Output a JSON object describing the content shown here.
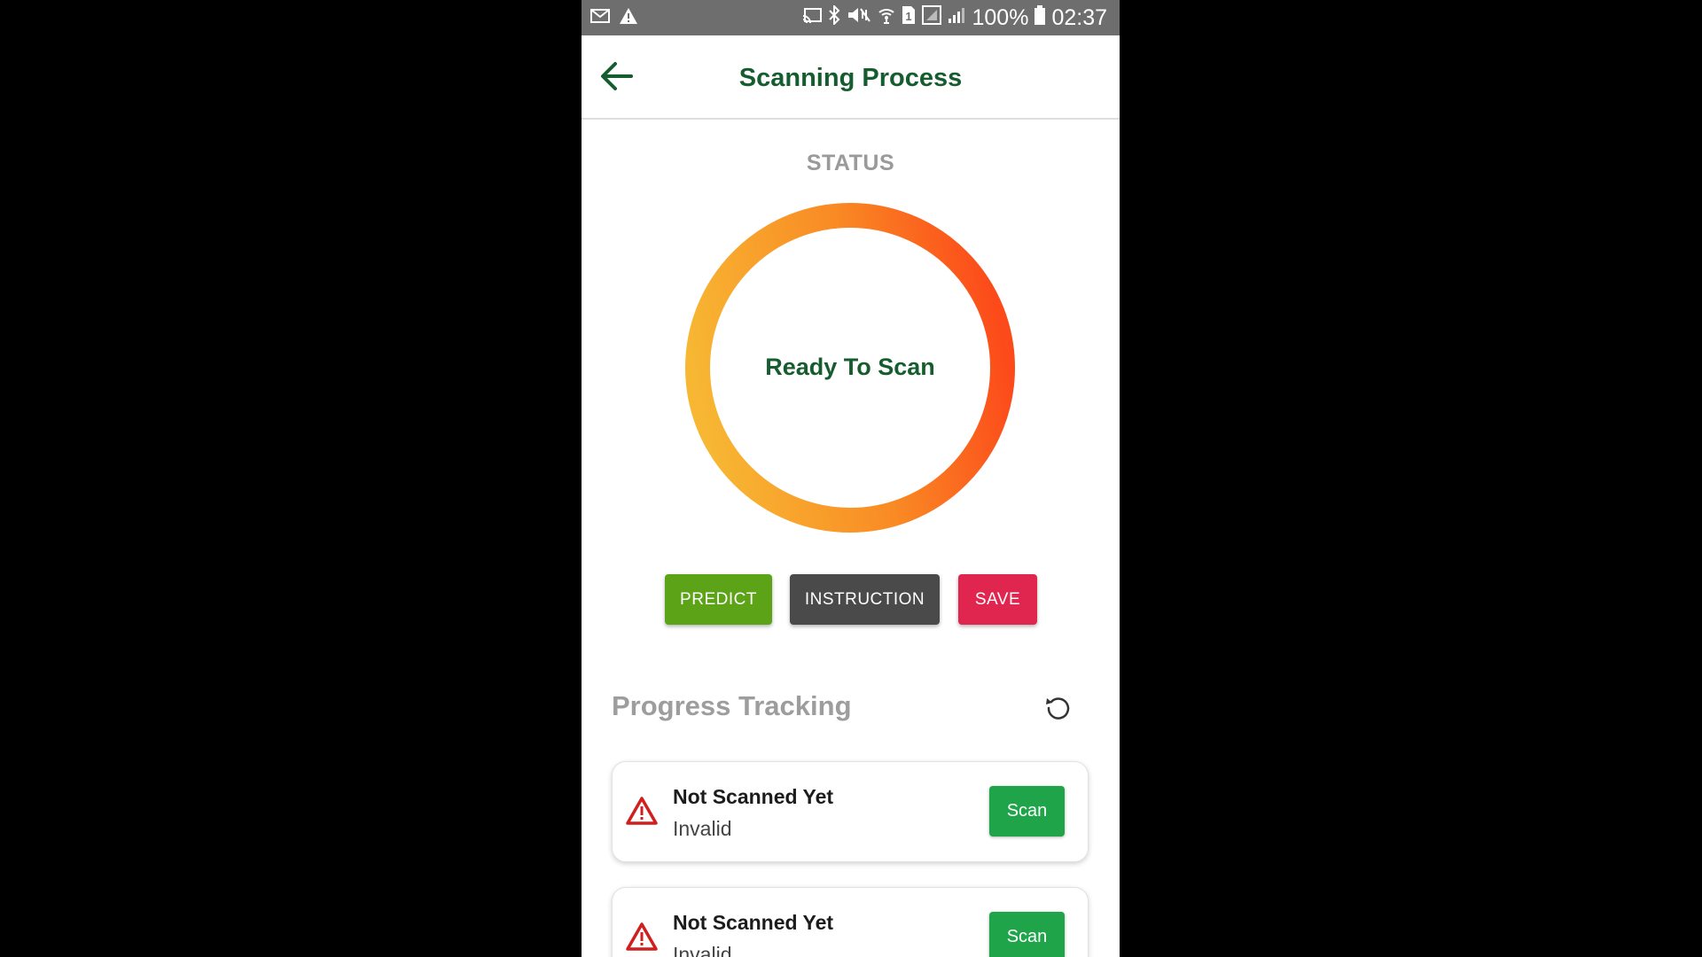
{
  "status_bar": {
    "battery": "100%",
    "time": "02:37",
    "sim_slot": "1",
    "left_icons": [
      "mail-icon",
      "warning-icon"
    ],
    "right_icons": [
      "cast-icon",
      "bluetooth-icon",
      "mute-icon",
      "wifi-icon",
      "sim-icon",
      "signal-box-icon",
      "signal-icon",
      "battery-icon"
    ]
  },
  "app_bar": {
    "title": "Scanning Process",
    "back_icon": "arrow-left-icon"
  },
  "status": {
    "label": "STATUS",
    "ring_text": "Ready To Scan",
    "ring_colors": [
      "#f7b733",
      "#fc4a1a"
    ]
  },
  "actions": {
    "predict": "PREDICT",
    "instruction": "INSTRUCTION",
    "save": "SAVE"
  },
  "progress": {
    "title": "Progress Tracking",
    "refresh_icon": "refresh-icon",
    "items": [
      {
        "title": "Not Scanned Yet",
        "subtitle": "Invalid",
        "button": "Scan",
        "icon": "warning-icon"
      },
      {
        "title": "Not Scanned Yet",
        "subtitle": "Invalid",
        "button": "Scan",
        "icon": "warning-icon"
      }
    ]
  },
  "colors": {
    "brand_green": "#155d2f",
    "predict": "#5da318",
    "instruction": "#4a4a4a",
    "save": "#e0254f",
    "scan": "#1fa44a",
    "warning": "#d01f1f"
  }
}
